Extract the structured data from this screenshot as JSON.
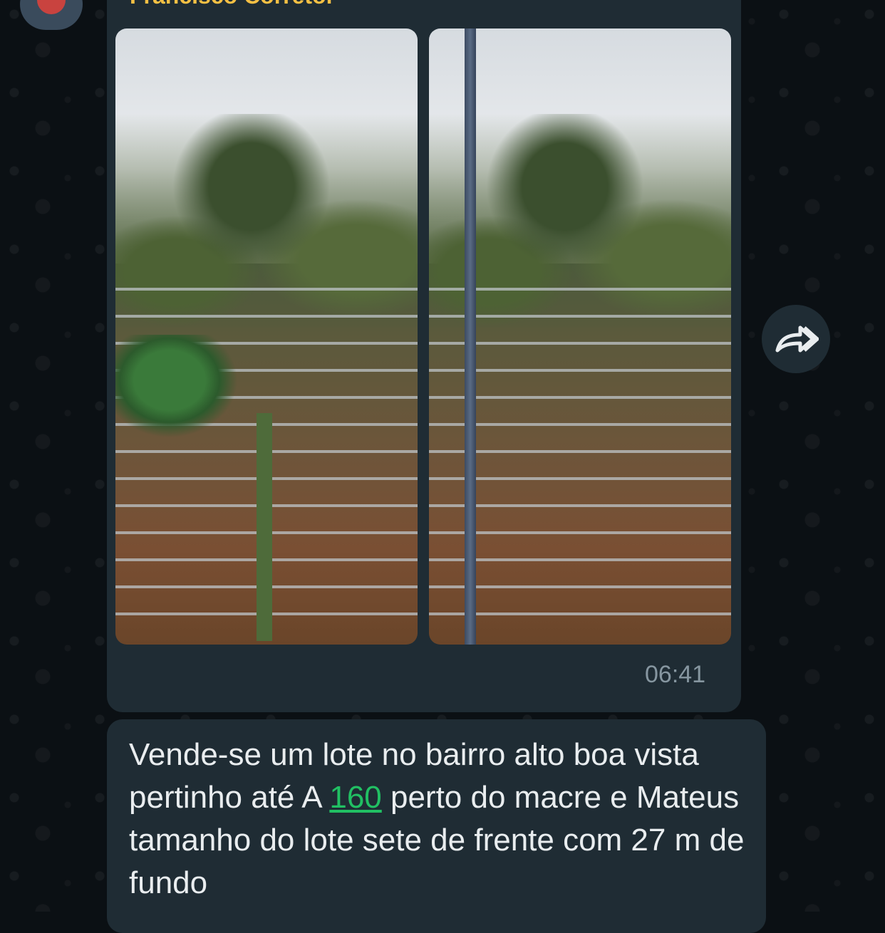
{
  "sender": {
    "name": "Francisco Corretor"
  },
  "media_message": {
    "time": "06:41"
  },
  "text_message": {
    "part1": "Vende-se um lote no bairro alto boa vista pertinho até A ",
    "number": "160",
    "part2": " perto do macre e Mateus tamanho do lote sete de frente com 27 m de fundo"
  },
  "icons": {
    "avatar": "contact-avatar",
    "forward": "forward-icon"
  },
  "colors": {
    "background": "#0b1014",
    "bubble": "#1f2c34",
    "sender_name": "#f5c044",
    "text": "#e9edef",
    "timestamp": "#8696a0",
    "number_link": "#21c063"
  }
}
